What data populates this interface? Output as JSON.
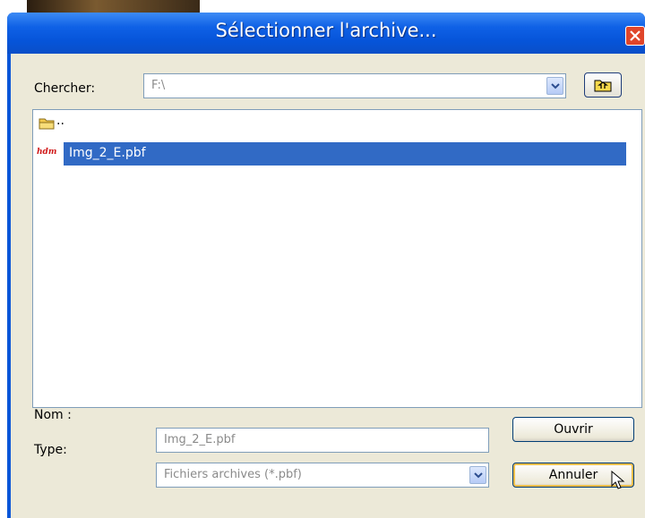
{
  "dialog": {
    "title": "Sélectionner l'archive..."
  },
  "search": {
    "label": "Chercher:",
    "value": "F:\\"
  },
  "files": {
    "parent_label": "..",
    "items": [
      {
        "label": "Img_2_E.pbf",
        "icon_text": "hdm",
        "selected": true
      }
    ]
  },
  "name_field": {
    "label": "Nom :",
    "value": "Img_2_E.pbf"
  },
  "type_field": {
    "label": "Type:",
    "value": "Fichiers archives (*.pbf)"
  },
  "buttons": {
    "open": "Ouvrir",
    "cancel": "Annuler"
  },
  "colors": {
    "title_bar": "#0654d9",
    "selection": "#316ac5",
    "close_button": "#e0452a",
    "client_background": "#ece9d8"
  }
}
